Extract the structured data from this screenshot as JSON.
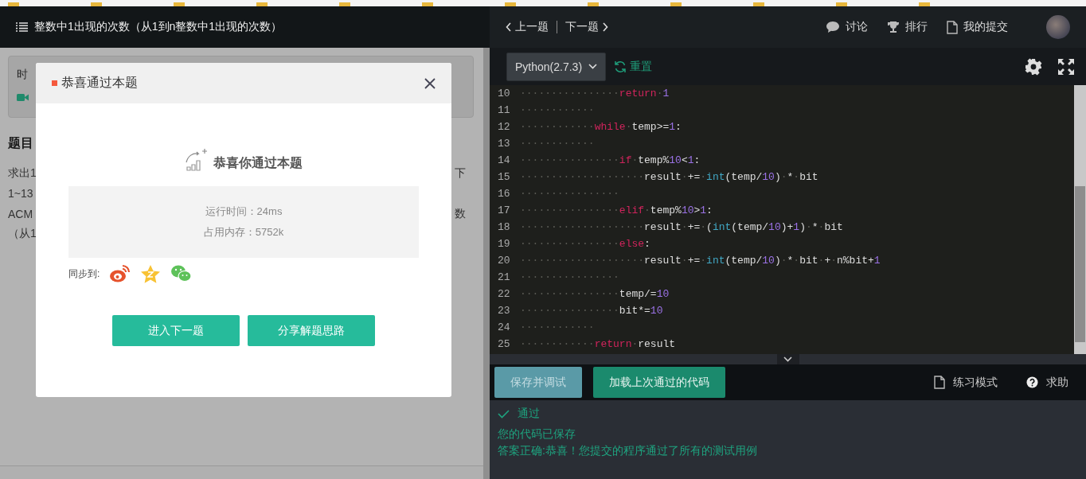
{
  "header": {
    "title": "整数中1出现的次数（从1到n整数中1出现的次数）",
    "prev": "上一题",
    "next": "下一题",
    "links": [
      {
        "label": "讨论",
        "kind": "chat"
      },
      {
        "label": "排行",
        "kind": "trophy"
      },
      {
        "label": "我的提交",
        "kind": "doc"
      }
    ]
  },
  "problem": {
    "info_label": "时",
    "heading": "题目",
    "lines": [
      {
        "left": "求出1",
        "right": "下"
      },
      {
        "left": "1~13"
      },
      {
        "left": "ACM",
        "right": "数"
      },
      {
        "left": "（从1"
      }
    ]
  },
  "dialog": {
    "title": "恭喜通过本题",
    "headline": "恭喜你通过本题",
    "stats": [
      "运行时间：24ms",
      "占用内存：5752k"
    ],
    "share_label": "同步到:",
    "share": [
      {
        "kind": "weibo"
      },
      {
        "kind": "qzone"
      },
      {
        "kind": "wechat"
      }
    ],
    "buttons": [
      "进入下一题",
      "分享解题思路"
    ]
  },
  "editor": {
    "language": "Python(2.7.3)",
    "reset": "重置",
    "lines": [
      {
        "number": "10",
        "tokens": [
          {
            "kind": "id",
            "text": "················"
          },
          {
            "kind": "kw",
            "text": "return"
          },
          {
            "kind": "id",
            "text": "·"
          },
          {
            "kind": "num",
            "text": "1"
          }
        ]
      },
      {
        "number": "11",
        "tokens": [
          {
            "kind": "id",
            "text": "············"
          }
        ]
      },
      {
        "number": "12",
        "tokens": [
          {
            "kind": "id",
            "text": "············"
          },
          {
            "kind": "kw",
            "text": "while"
          },
          {
            "kind": "id",
            "text": "·temp>="
          },
          {
            "kind": "num",
            "text": "1"
          },
          {
            "kind": "id",
            "text": ":"
          }
        ]
      },
      {
        "number": "13",
        "tokens": [
          {
            "kind": "id",
            "text": "············"
          }
        ]
      },
      {
        "number": "14",
        "tokens": [
          {
            "kind": "id",
            "text": "················"
          },
          {
            "kind": "kw",
            "text": "if"
          },
          {
            "kind": "id",
            "text": "·temp%"
          },
          {
            "kind": "num",
            "text": "10"
          },
          {
            "kind": "id",
            "text": "<"
          },
          {
            "kind": "num",
            "text": "1"
          },
          {
            "kind": "id",
            "text": ":"
          }
        ]
      },
      {
        "number": "15",
        "tokens": [
          {
            "kind": "id",
            "text": "····················result·+=·"
          },
          {
            "kind": "fn",
            "text": "int"
          },
          {
            "kind": "id",
            "text": "(temp/"
          },
          {
            "kind": "num",
            "text": "10"
          },
          {
            "kind": "id",
            "text": ")·*·bit"
          }
        ]
      },
      {
        "number": "16",
        "tokens": [
          {
            "kind": "id",
            "text": "················"
          }
        ]
      },
      {
        "number": "17",
        "tokens": [
          {
            "kind": "id",
            "text": "················"
          },
          {
            "kind": "kw",
            "text": "elif"
          },
          {
            "kind": "id",
            "text": "·temp%"
          },
          {
            "kind": "num",
            "text": "10"
          },
          {
            "kind": "id",
            "text": ">"
          },
          {
            "kind": "num",
            "text": "1"
          },
          {
            "kind": "id",
            "text": ":"
          }
        ]
      },
      {
        "number": "18",
        "tokens": [
          {
            "kind": "id",
            "text": "····················result·+=·("
          },
          {
            "kind": "fn",
            "text": "int"
          },
          {
            "kind": "id",
            "text": "(temp/"
          },
          {
            "kind": "num",
            "text": "10"
          },
          {
            "kind": "id",
            "text": ")+"
          },
          {
            "kind": "num",
            "text": "1"
          },
          {
            "kind": "id",
            "text": ")·*·bit"
          }
        ]
      },
      {
        "number": "19",
        "tokens": [
          {
            "kind": "id",
            "text": "················"
          },
          {
            "kind": "kw",
            "text": "else"
          },
          {
            "kind": "id",
            "text": ":"
          }
        ]
      },
      {
        "number": "20",
        "tokens": [
          {
            "kind": "id",
            "text": "····················result·+=·"
          },
          {
            "kind": "fn",
            "text": "int"
          },
          {
            "kind": "id",
            "text": "(temp/"
          },
          {
            "kind": "num",
            "text": "10"
          },
          {
            "kind": "id",
            "text": ")·*·bit·+·n%bit+"
          },
          {
            "kind": "num",
            "text": "1"
          }
        ]
      },
      {
        "number": "21",
        "tokens": [
          {
            "kind": "id",
            "text": "················"
          }
        ]
      },
      {
        "number": "22",
        "tokens": [
          {
            "kind": "id",
            "text": "················temp/="
          },
          {
            "kind": "num",
            "text": "10"
          }
        ]
      },
      {
        "number": "23",
        "tokens": [
          {
            "kind": "id",
            "text": "················bit*="
          },
          {
            "kind": "num",
            "text": "10"
          }
        ]
      },
      {
        "number": "24",
        "tokens": [
          {
            "kind": "id",
            "text": "············"
          }
        ]
      },
      {
        "number": "25",
        "tokens": [
          {
            "kind": "id",
            "text": "············"
          },
          {
            "kind": "kw",
            "text": "return"
          },
          {
            "kind": "id",
            "text": "·result"
          }
        ]
      }
    ]
  },
  "actions": {
    "buttons": [
      {
        "label": "保存并调试",
        "kind": "debug"
      },
      {
        "label": "加载上次通过的代码",
        "kind": "load"
      }
    ],
    "links": [
      {
        "label": "练习模式",
        "kind": "doc"
      },
      {
        "label": "求助",
        "kind": "help"
      }
    ]
  },
  "result": {
    "status": "通过",
    "messages": [
      "您的代码已保存",
      "答案正确:恭喜！您提交的程序通过了所有的测试用例"
    ]
  }
}
